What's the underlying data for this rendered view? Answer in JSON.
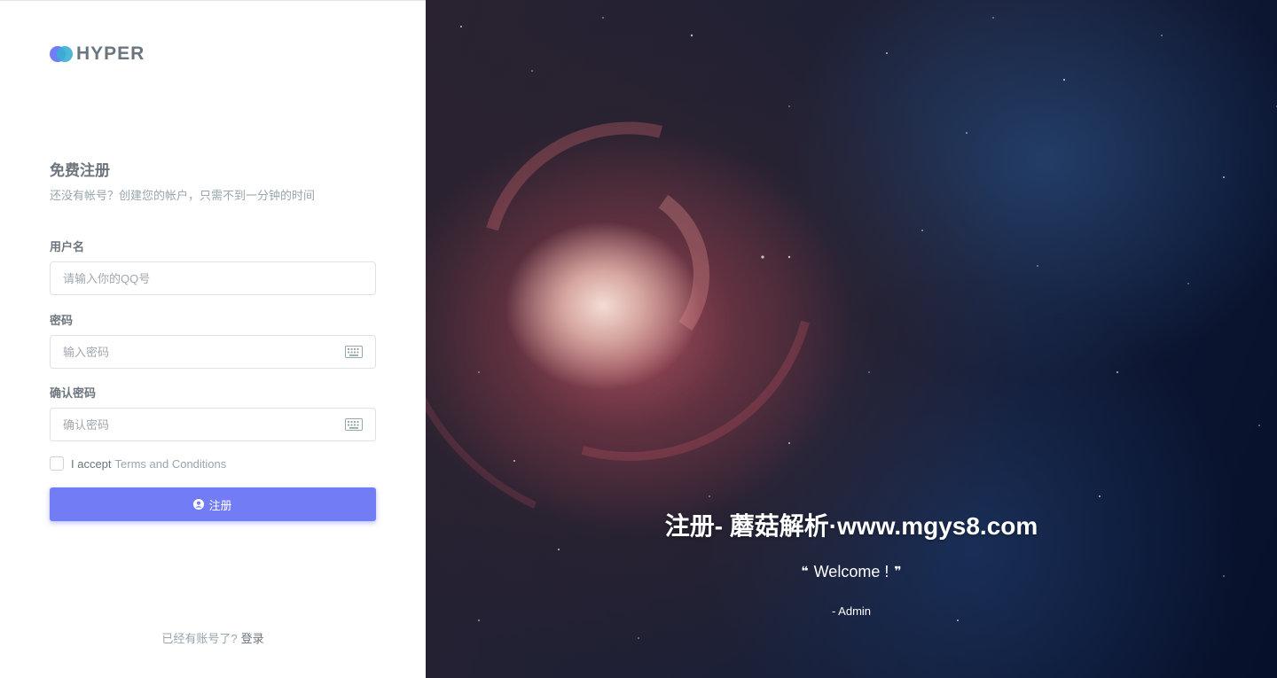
{
  "brand": {
    "name": "HYPER",
    "colors": {
      "primary": "#727cf5",
      "secondary": "#39afd1"
    }
  },
  "form": {
    "title": "免费注册",
    "subtitle": "还没有帐号？创建您的帐户，只需不到一分钟的时间",
    "username": {
      "label": "用户名",
      "placeholder": "请输入你的QQ号",
      "value": ""
    },
    "password": {
      "label": "密码",
      "placeholder": "输入密码",
      "value": "",
      "icon": "keyboard-icon"
    },
    "confirm_password": {
      "label": "确认密码",
      "placeholder": "确认密码",
      "value": "",
      "icon": "keyboard-icon"
    },
    "terms": {
      "checked": false,
      "prefix": "I accept",
      "link": "Terms and Conditions"
    },
    "submit": {
      "label": "注册",
      "icon": "user-circle-icon"
    }
  },
  "footer": {
    "text": "已经有账号了?",
    "link": "登录"
  },
  "hero": {
    "title": "注册- 蘑菇解析·www.mgys8.com",
    "quote": "Welcome !",
    "author": "- Admin"
  }
}
